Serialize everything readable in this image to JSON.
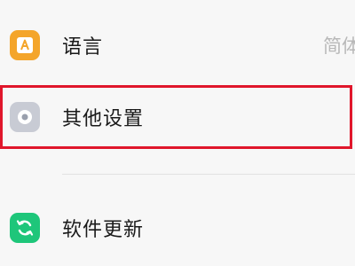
{
  "settings": {
    "items": [
      {
        "label": "语言",
        "value": "简体",
        "icon": "language-icon",
        "icon_color": "#f4a52a"
      },
      {
        "label": "其他设置",
        "icon": "other-settings-icon",
        "icon_color": "#c8cbd4"
      },
      {
        "label": "软件更新",
        "icon": "software-update-icon",
        "icon_color": "#1ec67a"
      }
    ]
  },
  "highlight_color": "#e0162b"
}
